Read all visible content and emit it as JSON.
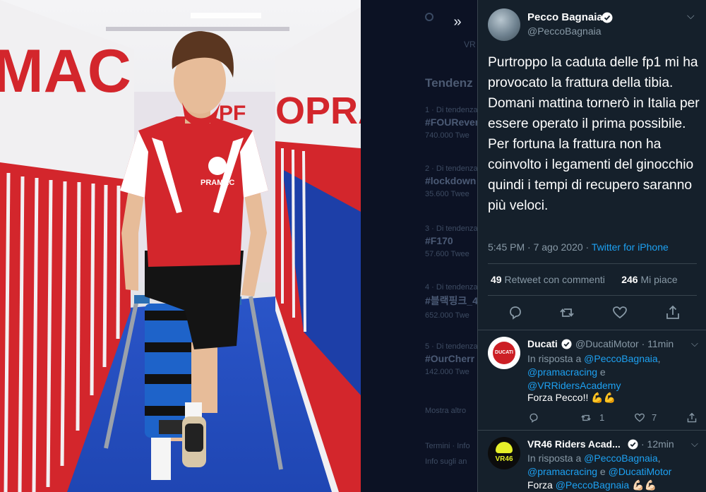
{
  "viewer": {
    "collapse_label": "»"
  },
  "background_trends": {
    "tag": "VR",
    "heading": "Tendenz",
    "items": [
      {
        "meta": "1 · Di tendenza",
        "name": "#FOURever",
        "count": "740.000 Twe"
      },
      {
        "meta": "2 · Di tendenza",
        "name": "#lockdown",
        "count": "35.600 Twee"
      },
      {
        "meta": "3 · Di tendenza",
        "name": "#F170",
        "count": "57.600 Twee"
      },
      {
        "meta": "4 · Di tendenza",
        "name": "#블랙핑크_4",
        "count": "652.000 Twe"
      },
      {
        "meta": "5 · Di tendenza",
        "name": "#OurCherr",
        "count": "142.000 Twe"
      }
    ],
    "show_more": "Mostra altro",
    "footer_1": "Termini · Info",
    "footer_2": "Info sugli an"
  },
  "photo": {
    "wall_text_left": "MAC",
    "wall_text_right": "OPRA",
    "jersey_text": "PRAMAC"
  },
  "tweet": {
    "author_name": "Pecco Bagnaia",
    "author_handle": "@PeccoBagnaia",
    "text": "Purtroppo la caduta delle fp1 mi ha provocato la frattura della tibia. Domani mattina tornerò in Italia per essere operato il prima possibile.\nPer fortuna la frattura non ha coinvolto i legamenti del ginocchio quindi i tempi di recupero saranno più veloci.",
    "time": "5:45 PM · 7 ago 2020 · ",
    "source": "Twitter for iPhone",
    "retweets_count": "49",
    "retweets_label": "Retweet con commenti",
    "likes_count": "246",
    "likes_label": "Mi piace"
  },
  "replies": [
    {
      "name": "Ducati",
      "handle": "@DucatiMotor · 11min",
      "reply_prefix": "In risposta a ",
      "reply_to_1": "@PeccoBagnaia",
      "reply_to_2": "@pramacracing",
      "reply_and": " e",
      "reply_to_3": "@VRRidersAcademy",
      "text": "Forza Pecco!! 💪💪",
      "retweets": "1",
      "likes": "7",
      "avatar_text": "DUCATI"
    },
    {
      "name": "VR46 Riders Acad...",
      "handle": "· 12min",
      "reply_prefix": "In risposta a ",
      "reply_to_1": "@PeccoBagnaia",
      "reply_to_2": "@pramacracing",
      "reply_and": " e ",
      "reply_to_3": "@DucatiMotor",
      "text_prefix": "Forza ",
      "text_mention": "@PeccoBagnaia",
      "text_suffix": " 💪🏻💪🏻",
      "avatar_text": "VR46"
    }
  ],
  "colors": {
    "background": "#15202b",
    "accent": "#1da1f2",
    "muted": "#8899a6",
    "border": "#38444d"
  }
}
